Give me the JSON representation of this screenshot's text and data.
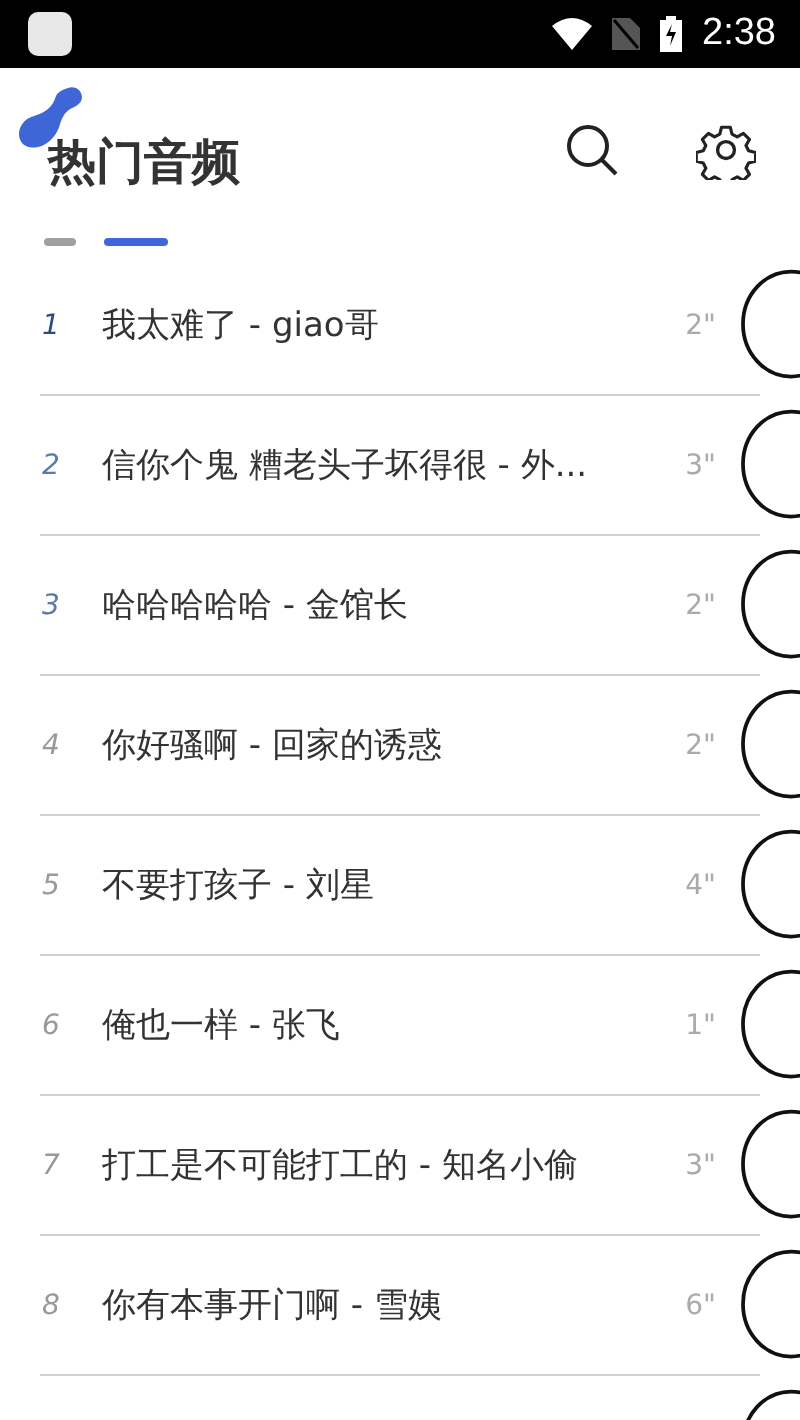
{
  "status_bar": {
    "time": "2:38"
  },
  "header": {
    "title": "热门音频"
  },
  "page_indicator": [
    {
      "selected": false
    },
    {
      "selected": true
    }
  ],
  "tracks": [
    {
      "rank": "1",
      "title": "我太难了 - giao哥",
      "duration": "2\"",
      "top": true
    },
    {
      "rank": "2",
      "title": "信你个鬼 糟老头子坏得很 - 外...",
      "duration": "3\"",
      "top": true
    },
    {
      "rank": "3",
      "title": "哈哈哈哈哈 - 金馆长",
      "duration": "2\"",
      "top": true
    },
    {
      "rank": "4",
      "title": "你好骚啊 - 回家的诱惑",
      "duration": "2\"",
      "top": false
    },
    {
      "rank": "5",
      "title": "不要打孩子 - 刘星",
      "duration": "4\"",
      "top": false
    },
    {
      "rank": "6",
      "title": "俺也一样 - 张飞",
      "duration": "1\"",
      "top": false
    },
    {
      "rank": "7",
      "title": "打工是不可能打工的 - 知名小偷",
      "duration": "3\"",
      "top": false
    },
    {
      "rank": "8",
      "title": "你有本事开门啊 - 雪姨",
      "duration": "6\"",
      "top": false
    }
  ]
}
